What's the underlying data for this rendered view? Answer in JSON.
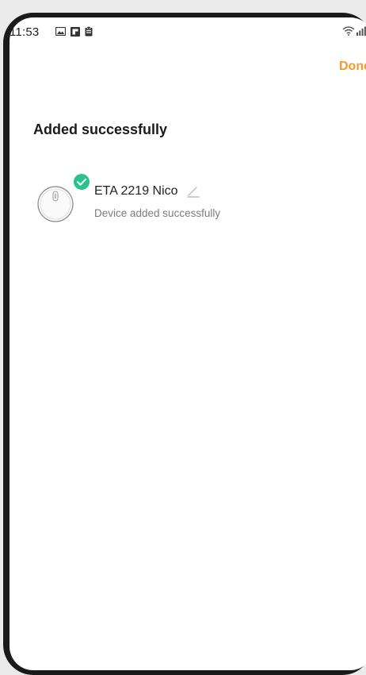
{
  "status_bar": {
    "time": "11:53",
    "notification_icons": [
      "image-icon",
      "flipboard-icon",
      "clipboard-icon"
    ],
    "right_icons": [
      "wifi-icon",
      "signal-icon",
      "battery-icon"
    ]
  },
  "header": {
    "done_label": "Done"
  },
  "main": {
    "title": "Added successfully",
    "devices": [
      {
        "name": "ETA 2219 Nico",
        "status": "Device added successfully",
        "icon": "robot-vacuum-icon",
        "badge": "check-icon",
        "action_icon": "edit-icon"
      }
    ]
  },
  "colors": {
    "accent": "#f39a2d",
    "success": "#27c28e",
    "text_primary": "#222222",
    "text_secondary": "#7c7c7c"
  }
}
